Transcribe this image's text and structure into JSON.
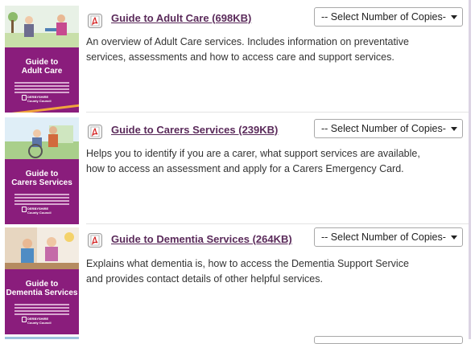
{
  "items": [
    {
      "title": "Guide to Adult Care (698KB)",
      "description_lines": [
        "An overview of Adult Care services. Includes information on preventative",
        "services, assessments and how to access care and support services."
      ],
      "select_value": "-- Select Number of Copies-",
      "cover": {
        "title_lines": [
          "Guide to",
          "Adult Care"
        ],
        "logo_text": [
          "DERBYSHIRE",
          "County Council"
        ]
      }
    },
    {
      "title": "Guide to Carers Services (239KB)",
      "description_lines": [
        "Helps you to identify if you are a carer, what support services are available,",
        "how to access an assessment and apply for a Carers Emergency Card."
      ],
      "select_value": "-- Select Number of Copies-",
      "cover": {
        "title_lines": [
          "Guide to",
          "Carers Services"
        ],
        "logo_text": [
          "DERBYSHIRE",
          "County Council"
        ]
      }
    },
    {
      "title": "Guide to Dementia Services (264KB)",
      "description_lines": [
        "Explains what dementia is, how to access the Dementia Support Service",
        "and provides contact details of other helpful services."
      ],
      "select_value": "-- Select Number of Copies-",
      "cover": {
        "title_lines": [
          "Guide to",
          "Dementia Services"
        ],
        "logo_text": [
          "DERBYSHIRE",
          "County Council"
        ]
      }
    }
  ],
  "icons": {
    "document": "pdf-icon",
    "dropdown": "chevron-down-icon"
  },
  "colors": {
    "cover_purple": "#8a1d7c",
    "link": "#5a2a5a",
    "accent_stripe": "#f0a53c"
  }
}
